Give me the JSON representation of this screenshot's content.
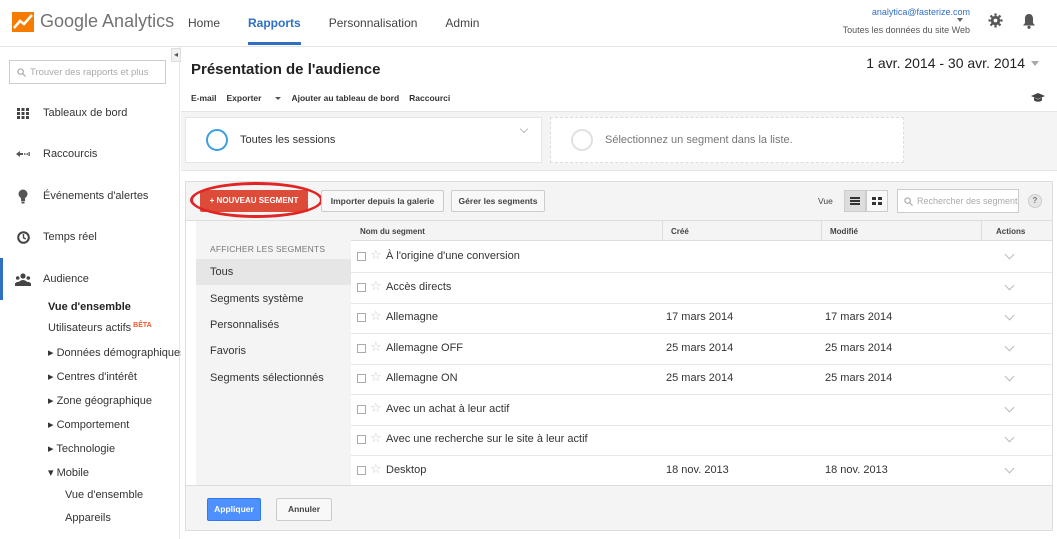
{
  "app": {
    "logo_text": "Google Analytics"
  },
  "topnav": {
    "items": [
      {
        "label": "Home"
      },
      {
        "label": "Rapports"
      },
      {
        "label": "Personnalisation"
      },
      {
        "label": "Admin"
      }
    ],
    "active_index": 1
  },
  "account": {
    "email": "analytica@fasterize.com",
    "property": "Toutes les données du site Web"
  },
  "sidebar": {
    "search_placeholder": "Trouver des rapports et plus",
    "items": [
      {
        "label": "Tableaux de bord",
        "icon": "dashboard-grid-icon"
      },
      {
        "label": "Raccourcis",
        "icon": "shortcut-arrow-icon"
      },
      {
        "label": "Événements d'alertes",
        "icon": "lightbulb-icon"
      },
      {
        "label": "Temps réel",
        "icon": "clock-icon"
      },
      {
        "label": "Audience",
        "icon": "people-icon"
      }
    ],
    "sub": {
      "overview": "Vue d'ensemble",
      "active_users": "Utilisateurs actifs",
      "beta": "BÊTA",
      "demographics": "▸ Données démographiques",
      "interests": "▸ Centres d'intérêt",
      "geo": "▸ Zone géographique",
      "behavior": "▸ Comportement",
      "technology": "▸ Technologie",
      "mobile": "▾ Mobile",
      "mobile_overview": "Vue d'ensemble",
      "devices": "Appareils"
    }
  },
  "main": {
    "title": "Présentation de l'audience",
    "date_range": "1 avr. 2014 - 30 avr. 2014",
    "actions": {
      "email": "E-mail",
      "export": "Exporter",
      "add_dashboard": "Ajouter au tableau de bord",
      "shortcut": "Raccourci"
    },
    "segments": {
      "selected": "Toutes les sessions",
      "empty": "Sélectionnez un segment dans la liste."
    }
  },
  "segment_panel": {
    "new_segment": "+ NOUVEAU SEGMENT",
    "import_gallery": "Importer depuis la galerie",
    "manage": "Gérer les segments",
    "view_label": "Vue",
    "search_placeholder": "Rechercher des segments",
    "help": "?",
    "list_header": "AFFICHER LES SEGMENTS",
    "list": [
      "Tous",
      "Segments système",
      "Personnalisés",
      "Favoris",
      "Segments sélectionnés"
    ],
    "selected_list_index": 0,
    "columns": {
      "name": "Nom du segment",
      "created": "Créé",
      "modified": "Modifié",
      "actions": "Actions"
    },
    "rows": [
      {
        "name": "À l'origine d'une conversion",
        "created": "",
        "modified": ""
      },
      {
        "name": "Accès directs",
        "created": "",
        "modified": ""
      },
      {
        "name": "Allemagne",
        "created": "17 mars 2014",
        "modified": "17 mars 2014"
      },
      {
        "name": "Allemagne OFF",
        "created": "25 mars 2014",
        "modified": "25 mars 2014"
      },
      {
        "name": "Allemagne ON",
        "created": "25 mars 2014",
        "modified": "25 mars 2014"
      },
      {
        "name": "Avec un achat à leur actif",
        "created": "",
        "modified": ""
      },
      {
        "name": "Avec une recherche sur le site à leur actif",
        "created": "",
        "modified": ""
      },
      {
        "name": "Desktop",
        "created": "18 nov. 2013",
        "modified": "18 nov. 2013"
      }
    ],
    "apply": "Appliquer",
    "cancel": "Annuler"
  },
  "colors": {
    "accent": "#2f6fc4",
    "new_segment": "#dd4b39",
    "annotation_ring": "#e12424",
    "apply": "#4d90fe"
  }
}
